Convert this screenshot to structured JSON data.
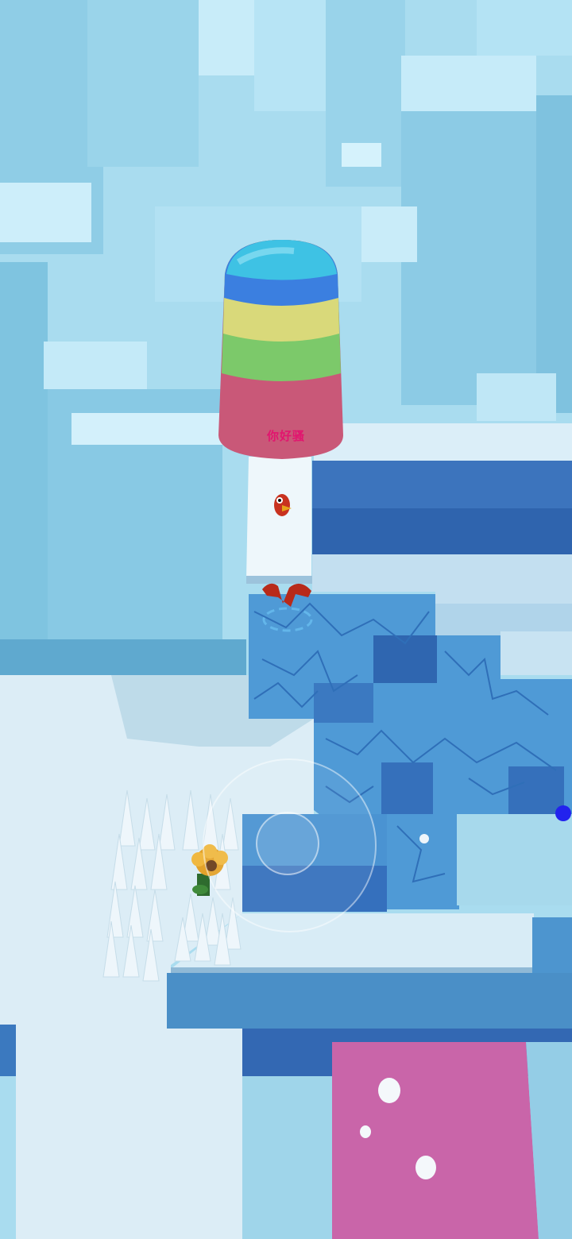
{
  "tower": {
    "label": "你好骚",
    "stripe_colors": [
      "#3ec2e4",
      "#3b7fe0",
      "#d9d97a",
      "#7cc96a",
      "#c95878"
    ]
  },
  "colors": {
    "sky": "#a9dcef",
    "platform_top": "#dff0f8",
    "platform_side": "#3a78c4",
    "cracked_ice": "#4f9ad6",
    "pink_pad": "#c965a9",
    "spikes": "#eef6fb",
    "direction_marker": "#2222ee"
  },
  "icons": {
    "player": "red-bird-character",
    "obstacle": "spikes",
    "pickup": "sunflower",
    "control": "virtual-joystick"
  }
}
